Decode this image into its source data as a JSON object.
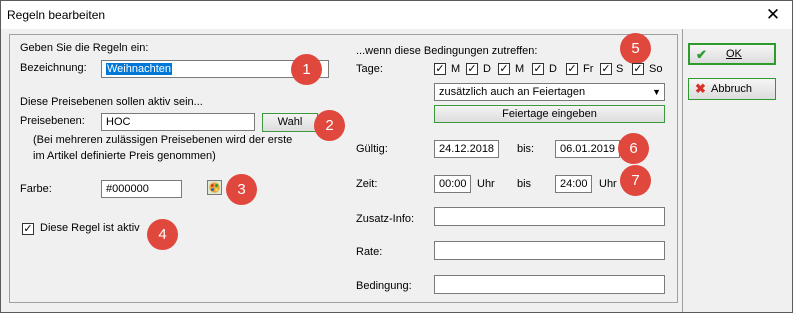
{
  "window": {
    "title": "Regeln bearbeiten",
    "close_glyph": "✕"
  },
  "left": {
    "intro": "Geben Sie die Regeln ein:",
    "name_label": "Bezeichnung:",
    "name_value": "Weihnachten",
    "price_levels_heading": "Diese Preisebenen sollen aktiv sein...",
    "price_levels_label": "Preisebenen:",
    "price_levels_value": "HOC",
    "choose_button": "Wahl",
    "note_line1": "(Bei mehreren zulässigen Preisebenen wird der erste",
    "note_line2": "im Artikel definierte Preis genommen)",
    "color_label": "Farbe:",
    "color_value": "#000000",
    "active_label": "Diese Regel ist aktiv",
    "active_checked": true
  },
  "right": {
    "heading": "...wenn diese Bedingungen zutreffen:",
    "days_label": "Tage:",
    "days": [
      {
        "label": "M",
        "checked": true
      },
      {
        "label": "D",
        "checked": true
      },
      {
        "label": "M",
        "checked": true
      },
      {
        "label": "D",
        "checked": true
      },
      {
        "label": "Fr",
        "checked": true
      },
      {
        "label": "S",
        "checked": true
      },
      {
        "label": "So",
        "checked": true
      }
    ],
    "holiday_option": "zusätzlich auch an Feiertagen",
    "holidays_button": "Feiertage eingeben",
    "valid_label": "Gültig:",
    "valid_from": "24.12.2018",
    "valid_to_label": "bis:",
    "valid_to": "06.01.2019",
    "time_label": "Zeit:",
    "time_from": "00:00",
    "uhr_label": "Uhr",
    "time_to_label": "bis",
    "time_to": "24:00",
    "extra_info_label": "Zusatz-Info:",
    "rate_label": "Rate:",
    "condition_label": "Bedingung:"
  },
  "actions": {
    "ok": "OK",
    "cancel": "Abbruch"
  },
  "annotations": [
    "1",
    "2",
    "3",
    "4",
    "5",
    "6",
    "7"
  ],
  "colors": {
    "badge": "#e0473d",
    "selection": "#0078d7",
    "ok_check": "#2e9b2e",
    "cancel_x": "#d8332a"
  }
}
